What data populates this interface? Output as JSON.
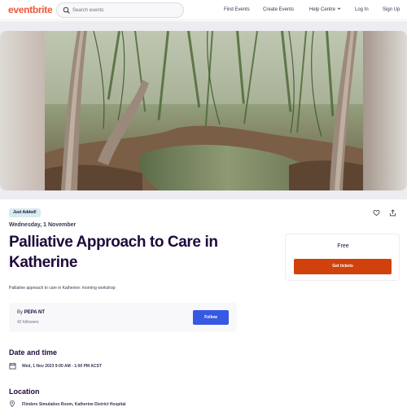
{
  "header": {
    "logo": "eventbrite",
    "search_placeholder": "Search events",
    "nav": {
      "find_events": "Find Events",
      "create_events": "Create Events",
      "help_centre": "Help Centre",
      "log_in": "Log In",
      "sign_up": "Sign Up"
    }
  },
  "event": {
    "badge": "Just Added!",
    "date": "Wednesday, 1 November",
    "title": "Palliative Approach to Care in Katherine",
    "summary": "Palliative approach to care in Katherine: morning workshop",
    "organizer": {
      "by_label": "By",
      "name": "PEPA NT",
      "followers": "42 followers",
      "follow_label": "Follow"
    },
    "date_time_heading": "Date and time",
    "date_time": "Wed, 1 Nov 2023 9:00 AM - 1:00 PM ACST",
    "location_heading": "Location",
    "location": "Flinders Simulation Room, Katherine District Hospital"
  },
  "ticket": {
    "price": "Free",
    "button": "Get tickets"
  },
  "colors": {
    "brand": "#f05537",
    "cta": "#d1410c",
    "follow": "#3659e3",
    "heading": "#1e0a3c"
  }
}
